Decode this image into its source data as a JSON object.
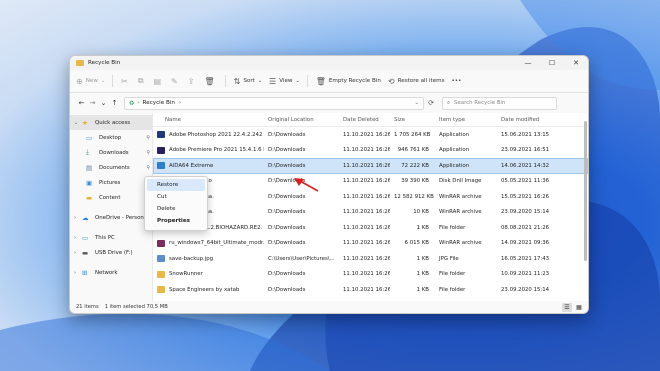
{
  "window": {
    "title": "Recycle Bin",
    "minimize_glyph": "—",
    "maximize_glyph": "☐",
    "close_glyph": "✕"
  },
  "toolbar": {
    "new_label": "New",
    "sort_label": "Sort",
    "view_label": "View",
    "empty_label": "Empty Recycle Bin",
    "restore_all_label": "Restore all items",
    "more_label": "•••"
  },
  "address": {
    "path": "Recycle Bin",
    "search_placeholder": "Search Recycle Bin"
  },
  "sidebar": {
    "items": [
      {
        "label": "Quick access"
      },
      {
        "label": "Desktop"
      },
      {
        "label": "Downloads"
      },
      {
        "label": "Documents"
      },
      {
        "label": "Pictures"
      },
      {
        "label": "Content"
      },
      {
        "label": "OneDrive - Personal"
      },
      {
        "label": "This PC"
      },
      {
        "label": "USB Drive (F:)"
      },
      {
        "label": "Network"
      }
    ]
  },
  "columns": {
    "name": "Name",
    "location": "Original Location",
    "deleted": "Date Deleted",
    "size": "Size",
    "type": "Item type",
    "modified": "Date modified"
  },
  "files": [
    {
      "name": "Adobe Photoshop 2021 22.4.2.242 R...",
      "location": "D:\\Downloads",
      "deleted": "11.10.2021 16:26",
      "size": "1 705 264 KB",
      "type": "Application",
      "modified": "15.06.2021 13:15",
      "icon_color": "#1f3c78"
    },
    {
      "name": "Adobe Premiere Pro 2021 15.4.1.6 R...",
      "location": "D:\\Downloads",
      "deleted": "11.10.2021 16:26",
      "size": "946 761 KB",
      "type": "Application",
      "modified": "23.09.2021 16:51",
      "icon_color": "#2a1f5e"
    },
    {
      "name": "AIDA64 Extreme",
      "location": "D:\\Downloads",
      "deleted": "11.10.2021 16:26",
      "size": "72 222 KB",
      "type": "Application",
      "modified": "14.06.2021 14:32",
      "icon_color": "#2e7fc9"
    },
    {
      "name": "Duplicate Photo",
      "location": "D:\\Downloads",
      "deleted": "11.10.2021 16:26",
      "size": "39 390 KB",
      "type": "Disk Dnll Image",
      "modified": "05.05.2021 11:36",
      "icon_color": "#8a8a8a"
    },
    {
      "name": "macOS Catalina.",
      "location": "D:\\Downloads",
      "deleted": "11.10.2021 16:26",
      "size": "12 582 912 KB",
      "type": "WinRAR archive",
      "modified": "15.05.2021 16:26",
      "icon_color": "#7a2e5a"
    },
    {
      "name": "macOS Catalina.",
      "location": "D:\\Downloads",
      "deleted": "11.10.2021 16:26",
      "size": "10 KB",
      "type": "WinRAR archive",
      "modified": "23.09.2020 15:14",
      "icon_color": "#7a2e5a"
    },
    {
      "name": "RESIDENT.EVIL.2.BIOHAZARD.RE2. R...",
      "location": "D:\\Downloads",
      "deleted": "11.10.2021 16:26",
      "size": "1 KB",
      "type": "File folder",
      "modified": "08.08.2021 21:26",
      "icon_color": "#e8b84a"
    },
    {
      "name": "ru_windows7_64bit_Ultimate_modr...",
      "location": "D:\\Downloads",
      "deleted": "11.10.2021 16:26",
      "size": "6 015 KB",
      "type": "WinRAR archive",
      "modified": "14.09.2021 09:36",
      "icon_color": "#7a2e5a"
    },
    {
      "name": "save-backup.jpg",
      "location": "C:\\Users\\User\\Pictures\\...",
      "deleted": "11.10.2021 16:26",
      "size": "1 KB",
      "type": "JPG File",
      "modified": "16.05.2021 17:43",
      "icon_color": "#5c8fc7"
    },
    {
      "name": "SnowRunner",
      "location": "D:\\Downloads",
      "deleted": "11.10.2021 16:26",
      "size": "1 KB",
      "type": "File folder",
      "modified": "10.09.2021 11:23",
      "icon_color": "#e8b84a"
    },
    {
      "name": "Space Engineers by xatab",
      "location": "D:\\Downloads",
      "deleted": "11.10.2021 16:26",
      "size": "1 KB",
      "type": "File folder",
      "modified": "23.09.2020 15:14",
      "icon_color": "#e8b84a"
    }
  ],
  "context_menu": {
    "restore": "Restore",
    "cut": "Cut",
    "delete": "Delete",
    "properties": "Properties"
  },
  "status": {
    "count": "21 items",
    "selected": "1 item selected  70,5 MB"
  }
}
